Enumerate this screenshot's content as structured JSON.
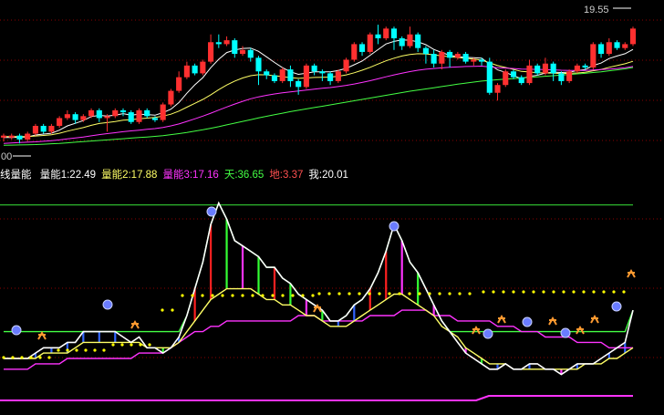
{
  "colors": {
    "up": "#ff3030",
    "down": "#00ffff",
    "ma_white": "#ffffff",
    "ma_yellow": "#ffff66",
    "ma_magenta": "#ff33ff",
    "ma_green": "#44ff44",
    "grid": "#8b0000",
    "label_white": "#ffffff",
    "label_yellow": "#ffff66",
    "label_magenta": "#ff33ff",
    "label_green": "#44ff44",
    "label_red": "#ff5050",
    "dots": "#ffff00",
    "top_line": "#33cc33",
    "bottom_line": "#ff33ff"
  },
  "top_panel": {
    "high_label": "19.55",
    "low_label": "00",
    "y_range": [
      13.0,
      20.5
    ]
  },
  "legend": {
    "indicator": "线量能",
    "items": [
      {
        "label": "量能1:22.49",
        "color": "label_white"
      },
      {
        "label": "量能2:17.88",
        "color": "label_yellow"
      },
      {
        "label": "量能3:17.16",
        "color": "label_magenta"
      },
      {
        "label": "天:36.65",
        "color": "label_green"
      },
      {
        "label": "地:3.37",
        "color": "label_red"
      },
      {
        "label": "我:20.01",
        "color": "label_white"
      }
    ]
  },
  "chart_data": [
    {
      "type": "candlestick",
      "ylim": [
        13.0,
        20.5
      ],
      "candles": [
        [
          13.9,
          14.0,
          13.7,
          14.1
        ],
        [
          13.9,
          14.0,
          13.8,
          14.1
        ],
        [
          14.0,
          13.8,
          13.6,
          14.1
        ],
        [
          13.8,
          14.1,
          13.7,
          14.2
        ],
        [
          14.1,
          14.5,
          14.0,
          14.6
        ],
        [
          14.5,
          14.2,
          14.1,
          14.6
        ],
        [
          14.2,
          14.5,
          14.1,
          14.6
        ],
        [
          14.5,
          14.9,
          14.4,
          15.0
        ],
        [
          14.9,
          15.1,
          14.8,
          15.3
        ],
        [
          15.1,
          14.8,
          14.6,
          15.2
        ],
        [
          14.8,
          15.0,
          14.7,
          15.1
        ],
        [
          15.0,
          15.3,
          14.9,
          15.4
        ],
        [
          15.3,
          14.9,
          14.7,
          15.4
        ],
        [
          14.9,
          15.0,
          14.2,
          15.1
        ],
        [
          15.0,
          15.3,
          14.9,
          15.4
        ],
        [
          15.3,
          15.2,
          15.0,
          15.4
        ],
        [
          15.2,
          14.7,
          14.6,
          15.3
        ],
        [
          14.7,
          15.3,
          14.6,
          15.4
        ],
        [
          15.3,
          15.0,
          14.9,
          15.4
        ],
        [
          14.9,
          14.8,
          14.7,
          15.0
        ],
        [
          14.8,
          15.6,
          14.7,
          15.7
        ],
        [
          15.6,
          16.3,
          15.5,
          16.4
        ],
        [
          16.3,
          17.0,
          16.2,
          17.3
        ],
        [
          17.0,
          17.6,
          16.9,
          17.8
        ],
        [
          17.6,
          17.2,
          17.1,
          17.7
        ],
        [
          17.2,
          17.8,
          17.1,
          17.9
        ],
        [
          17.8,
          18.8,
          17.7,
          19.2
        ],
        [
          18.8,
          18.7,
          18.5,
          19.2
        ],
        [
          18.7,
          18.9,
          18.6,
          19.1
        ],
        [
          18.9,
          18.2,
          18.0,
          19.0
        ],
        [
          18.2,
          18.4,
          18.1,
          18.6
        ],
        [
          18.4,
          18.0,
          17.8,
          18.5
        ],
        [
          18.0,
          17.3,
          16.6,
          18.1
        ],
        [
          17.3,
          17.1,
          16.9,
          17.4
        ],
        [
          17.1,
          16.8,
          16.7,
          17.2
        ],
        [
          16.8,
          17.4,
          16.7,
          17.5
        ],
        [
          17.4,
          16.8,
          16.5,
          17.6
        ],
        [
          16.8,
          16.5,
          16.1,
          16.9
        ],
        [
          16.5,
          17.6,
          16.4,
          17.7
        ],
        [
          17.6,
          17.3,
          17.1,
          17.7
        ],
        [
          17.3,
          17.2,
          16.8,
          17.4
        ],
        [
          17.2,
          16.8,
          16.6,
          17.3
        ],
        [
          16.8,
          17.3,
          16.7,
          17.4
        ],
        [
          17.3,
          17.9,
          17.2,
          18.0
        ],
        [
          17.9,
          18.7,
          17.8,
          18.8
        ],
        [
          18.7,
          18.3,
          18.1,
          18.8
        ],
        [
          18.3,
          19.2,
          18.2,
          19.3
        ],
        [
          19.2,
          19.0,
          18.7,
          19.7
        ],
        [
          19.0,
          19.5,
          18.9,
          19.6
        ],
        [
          19.5,
          19.0,
          18.4,
          19.6
        ],
        [
          19.0,
          18.6,
          18.4,
          19.1
        ],
        [
          18.6,
          19.2,
          18.5,
          19.6
        ],
        [
          19.2,
          18.5,
          18.3,
          19.3
        ],
        [
          18.5,
          18.2,
          17.7,
          18.6
        ],
        [
          18.2,
          17.7,
          17.5,
          18.4
        ],
        [
          17.7,
          18.3,
          17.4,
          18.4
        ],
        [
          18.3,
          18.0,
          17.5,
          18.4
        ],
        [
          18.0,
          18.2,
          17.9,
          18.3
        ],
        [
          18.2,
          17.8,
          17.7,
          18.3
        ],
        [
          17.8,
          17.9,
          17.6,
          18.0
        ],
        [
          17.9,
          17.8,
          17.6,
          18.0
        ],
        [
          17.8,
          16.2,
          16.1,
          18.0
        ],
        [
          16.2,
          16.6,
          15.8,
          16.7
        ],
        [
          16.6,
          17.3,
          16.5,
          17.4
        ],
        [
          17.3,
          17.0,
          16.9,
          17.4
        ],
        [
          17.0,
          16.7,
          16.6,
          17.1
        ],
        [
          16.7,
          17.6,
          16.6,
          17.9
        ],
        [
          17.6,
          17.2,
          17.1,
          17.7
        ],
        [
          17.2,
          17.7,
          17.1,
          18.0
        ],
        [
          17.7,
          17.2,
          16.8,
          17.8
        ],
        [
          17.2,
          16.8,
          16.6,
          17.3
        ],
        [
          16.8,
          17.3,
          16.7,
          17.4
        ],
        [
          17.3,
          17.6,
          17.2,
          17.7
        ],
        [
          17.6,
          17.5,
          17.4,
          17.7
        ],
        [
          17.5,
          18.7,
          17.4,
          18.8
        ],
        [
          18.7,
          18.2,
          18.0,
          18.8
        ],
        [
          18.2,
          18.8,
          18.1,
          19.0
        ],
        [
          18.8,
          18.5,
          18.4,
          18.9
        ],
        [
          18.5,
          18.7,
          18.4,
          18.8
        ],
        [
          18.7,
          19.5,
          18.6,
          19.6
        ]
      ],
      "ma": [
        {
          "color": "ma_white",
          "values": [
            13.9,
            13.9,
            13.92,
            13.93,
            14.03,
            14.08,
            14.12,
            14.28,
            14.5,
            14.63,
            14.77,
            14.98,
            15.04,
            15.0,
            15.05,
            15.13,
            15.05,
            15.1,
            15.08,
            15.05,
            15.18,
            15.36,
            15.7,
            16.18,
            16.61,
            16.98,
            17.49,
            17.92,
            18.27,
            18.4,
            18.48,
            18.5,
            18.33,
            18.05,
            17.76,
            17.49,
            17.28,
            17.15,
            17.21,
            17.28,
            17.28,
            17.28,
            17.34,
            17.46,
            17.64,
            17.83,
            18.13,
            18.42,
            18.71,
            18.84,
            18.92,
            18.9,
            18.82,
            18.67,
            18.43,
            18.27,
            18.13,
            18.06,
            18.02,
            18.0,
            17.98,
            17.67,
            17.38,
            17.25,
            17.08,
            16.92,
            17.04,
            17.1,
            17.21,
            17.26,
            17.24,
            17.26,
            17.34,
            17.39,
            17.6,
            17.73,
            17.96,
            18.09,
            18.21,
            18.43
          ]
        },
        {
          "color": "ma_yellow",
          "values": [
            13.95,
            13.95,
            13.95,
            13.95,
            13.98,
            14.01,
            14.04,
            14.12,
            14.23,
            14.32,
            14.41,
            14.53,
            14.62,
            14.67,
            14.72,
            14.79,
            14.82,
            14.86,
            14.9,
            14.93,
            15.0,
            15.1,
            15.26,
            15.46,
            15.66,
            15.86,
            16.1,
            16.36,
            16.6,
            16.8,
            16.96,
            17.08,
            17.13,
            17.12,
            17.08,
            17.03,
            16.98,
            16.94,
            16.96,
            16.99,
            17.0,
            17.01,
            17.05,
            17.12,
            17.23,
            17.36,
            17.51,
            17.68,
            17.84,
            17.98,
            18.09,
            18.17,
            18.21,
            18.2,
            18.15,
            18.1,
            18.05,
            18.01,
            17.97,
            17.93,
            17.88,
            17.74,
            17.6,
            17.5,
            17.4,
            17.3,
            17.27,
            17.23,
            17.22,
            17.21,
            17.19,
            17.2,
            17.22,
            17.25,
            17.33,
            17.4,
            17.51,
            17.6,
            17.69,
            17.82
          ]
        },
        {
          "color": "ma_magenta",
          "values": [
            13.6,
            13.62,
            13.64,
            13.66,
            13.68,
            13.71,
            13.74,
            13.78,
            13.83,
            13.88,
            13.93,
            13.99,
            14.05,
            14.1,
            14.15,
            14.2,
            14.24,
            14.28,
            14.32,
            14.36,
            14.42,
            14.5,
            14.6,
            14.73,
            14.86,
            15.0,
            15.15,
            15.31,
            15.47,
            15.62,
            15.76,
            15.89,
            15.99,
            16.07,
            16.14,
            16.2,
            16.25,
            16.29,
            16.34,
            16.39,
            16.43,
            16.47,
            16.52,
            16.58,
            16.65,
            16.73,
            16.82,
            16.92,
            17.02,
            17.12,
            17.21,
            17.29,
            17.36,
            17.41,
            17.45,
            17.48,
            17.51,
            17.53,
            17.55,
            17.56,
            17.57,
            17.53,
            17.49,
            17.47,
            17.45,
            17.42,
            17.41,
            17.4,
            17.39,
            17.38,
            17.36,
            17.35,
            17.35,
            17.35,
            17.37,
            17.39,
            17.42,
            17.45,
            17.49,
            17.55
          ]
        },
        {
          "color": "ma_green",
          "values": [
            13.5,
            13.51,
            13.52,
            13.53,
            13.54,
            13.56,
            13.58,
            13.6,
            13.63,
            13.66,
            13.69,
            13.72,
            13.75,
            13.78,
            13.81,
            13.84,
            13.87,
            13.9,
            13.93,
            13.96,
            14.0,
            14.05,
            14.1,
            14.16,
            14.23,
            14.3,
            14.38,
            14.46,
            14.55,
            14.64,
            14.73,
            14.82,
            14.91,
            14.99,
            15.07,
            15.15,
            15.23,
            15.3,
            15.37,
            15.44,
            15.51,
            15.58,
            15.65,
            15.72,
            15.79,
            15.86,
            15.93,
            16.0,
            16.07,
            16.14,
            16.21,
            16.28,
            16.34,
            16.4,
            16.46,
            16.52,
            16.58,
            16.64,
            16.7,
            16.75,
            16.8,
            16.84,
            16.87,
            16.9,
            16.93,
            16.96,
            16.99,
            17.02,
            17.05,
            17.08,
            17.11,
            17.14,
            17.17,
            17.2,
            17.24,
            17.28,
            17.33,
            17.38,
            17.43,
            17.5
          ]
        }
      ]
    },
    {
      "type": "line",
      "ylim": [
        0,
        40
      ],
      "top_level": 36.65,
      "bottom_level": 3.37,
      "series": [
        {
          "color": "label_white",
          "values": [
            8,
            8,
            8,
            8,
            9,
            10,
            10,
            10,
            11,
            11,
            13,
            13,
            13,
            13,
            13,
            12,
            11,
            12,
            10,
            10,
            9,
            10,
            12,
            16,
            21,
            26,
            33,
            37,
            34,
            30,
            29,
            28,
            27,
            25,
            25,
            23,
            22,
            20,
            19,
            18,
            17,
            15,
            15,
            16,
            18,
            19,
            21,
            24,
            28,
            33,
            30,
            26,
            24,
            21,
            18,
            15,
            13,
            11,
            9,
            8,
            7,
            6,
            6,
            7,
            6,
            6,
            7,
            7,
            6,
            6,
            5,
            6,
            7,
            7,
            7,
            8,
            9,
            10,
            11,
            17
          ]
        },
        {
          "color": "label_yellow",
          "values": [
            8,
            8,
            8,
            8,
            8,
            9,
            9,
            9,
            9,
            10,
            11,
            11,
            11,
            11,
            11,
            11,
            11,
            11,
            10,
            10,
            10,
            10,
            11,
            13,
            15,
            17,
            19,
            20,
            21,
            21,
            21,
            21,
            20,
            19,
            19,
            18,
            18,
            17,
            16,
            16,
            15,
            14,
            14,
            14,
            15,
            16,
            17,
            18,
            19,
            20,
            20,
            19,
            18,
            17,
            16,
            14,
            13,
            12,
            10,
            9,
            8,
            7,
            7,
            7,
            6,
            6,
            6,
            6,
            6,
            6,
            6,
            6,
            6,
            7,
            7,
            7,
            8,
            8,
            9,
            10
          ]
        },
        {
          "color": "label_magenta",
          "values": [
            6,
            6,
            6,
            6,
            7,
            7,
            7,
            7,
            8,
            8,
            8,
            8,
            8,
            8,
            8,
            8,
            8,
            9,
            9,
            9,
            9,
            10,
            11,
            12,
            13,
            13,
            14,
            14,
            15,
            15,
            15,
            15,
            15,
            15,
            15,
            15,
            15,
            16,
            16,
            16,
            15,
            15,
            15,
            15,
            15,
            15,
            16,
            16,
            16,
            16,
            17,
            17,
            17,
            17,
            16,
            16,
            16,
            15,
            15,
            15,
            15,
            15,
            14,
            14,
            14,
            13,
            13,
            13,
            12,
            12,
            12,
            12,
            11,
            11,
            11,
            11,
            10,
            10,
            10,
            10
          ]
        },
        {
          "color": "label_green",
          "values": [
            13,
            13,
            13,
            13,
            13,
            13,
            13,
            13,
            13,
            13,
            13,
            13,
            13,
            13,
            13,
            13,
            13,
            13,
            13,
            13,
            13,
            13,
            13,
            13,
            13,
            13,
            13,
            13,
            13,
            13,
            13,
            13,
            13,
            13,
            13,
            13,
            13,
            13,
            13,
            13,
            13,
            13,
            13,
            13,
            13,
            13,
            13,
            13,
            13,
            13,
            13,
            13,
            13,
            13,
            13,
            13,
            13,
            13,
            13,
            13,
            13,
            13,
            13,
            13,
            13,
            13,
            13,
            13,
            13,
            13,
            13,
            13,
            13,
            13,
            13,
            13,
            13,
            13,
            13,
            13
          ]
        }
      ]
    }
  ]
}
